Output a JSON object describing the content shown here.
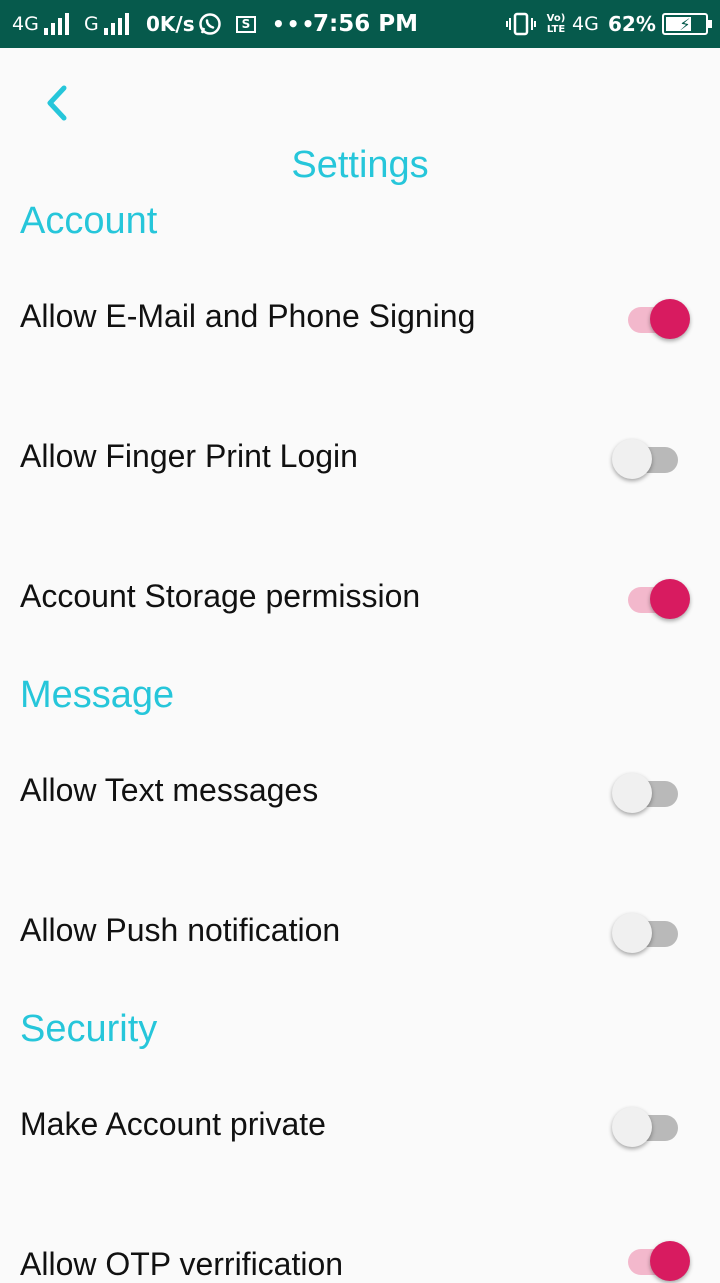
{
  "status_bar": {
    "net1": "4G",
    "net2": "G",
    "speed": "0K/s",
    "dots": "•••",
    "time": "7:56 PM",
    "volte": "Vo) LTE",
    "net3": "4G",
    "battery": "62%",
    "icons": [
      "signal-icon",
      "whatsapp-icon",
      "screenshot-icon",
      "vibrate-icon",
      "volte-icon",
      "battery-charging-icon"
    ]
  },
  "header": {
    "title": "Settings",
    "back_icon": "chevron-left-icon"
  },
  "sections": {
    "account": {
      "title": "Account",
      "items": [
        {
          "label": "Allow E-Mail and Phone Signing",
          "on": true
        },
        {
          "label": "Allow Finger Print Login",
          "on": false
        },
        {
          "label": "Account Storage permission",
          "on": true
        }
      ]
    },
    "message": {
      "title": "Message",
      "items": [
        {
          "label": "Allow Text messages",
          "on": false
        },
        {
          "label": "Allow Push notification",
          "on": false
        }
      ]
    },
    "security": {
      "title": "Security",
      "items": [
        {
          "label": "Make Account private",
          "on": false
        },
        {
          "label": "Allow OTP verrification",
          "on": true
        }
      ]
    }
  },
  "colors": {
    "status_bar": "#065a4c",
    "accent": "#26c6da",
    "switch_on": "#d81b60",
    "switch_on_track": "#f3b8cc",
    "switch_off_thumb": "#f0f0f0",
    "switch_off_track": "#b9b9b9"
  }
}
